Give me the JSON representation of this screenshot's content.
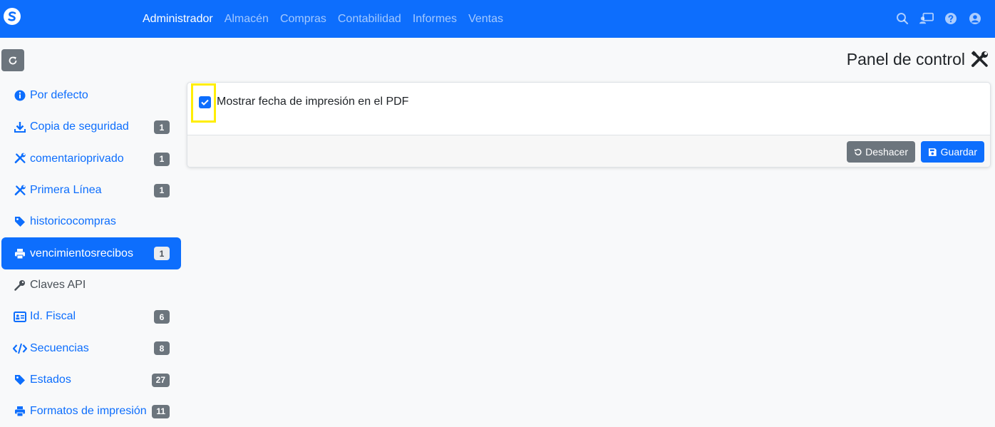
{
  "navbar": {
    "links": [
      {
        "label": "Administrador",
        "active": true
      },
      {
        "label": "Almacén"
      },
      {
        "label": "Compras"
      },
      {
        "label": "Contabilidad"
      },
      {
        "label": "Informes"
      },
      {
        "label": "Ventas"
      }
    ],
    "icons": [
      "search-icon",
      "chalkboard-user-icon",
      "question-circle-icon",
      "user-circle-icon"
    ],
    "color": "#0d6efd"
  },
  "page": {
    "title": "Panel de control"
  },
  "sidebar": {
    "items": [
      {
        "label": "Por defecto",
        "icon": "info-circle-icon",
        "badge": ""
      },
      {
        "label": "Copia de seguridad",
        "icon": "download-icon",
        "badge": "1"
      },
      {
        "label": "comentarioprivado",
        "icon": "tools-icon",
        "badge": "1"
      },
      {
        "label": "Primera Línea",
        "icon": "tools-icon",
        "badge": "1"
      },
      {
        "label": "historicocompras",
        "icon": "tags-icon",
        "badge": ""
      },
      {
        "label": "vencimientosrecibos",
        "icon": "print-icon",
        "badge": "1",
        "active": true
      },
      {
        "label": "Claves API",
        "icon": "key-icon",
        "badge": ""
      },
      {
        "label": "Id. Fiscal",
        "icon": "id-card-icon",
        "badge": "6"
      },
      {
        "label": "Secuencias",
        "icon": "code-icon",
        "badge": "8"
      },
      {
        "label": "Estados",
        "icon": "tags-icon",
        "badge": "27"
      },
      {
        "label": "Formatos de impresión",
        "icon": "print-icon",
        "badge": "11"
      }
    ]
  },
  "form": {
    "checkbox_label": "Mostrar fecha de impresión en el PDF",
    "checked": true,
    "undo_label": "Deshacer",
    "save_label": "Guardar"
  },
  "colors": {
    "primary": "#0d6efd",
    "secondary": "#6c757d",
    "highlight": "#ffee00"
  }
}
